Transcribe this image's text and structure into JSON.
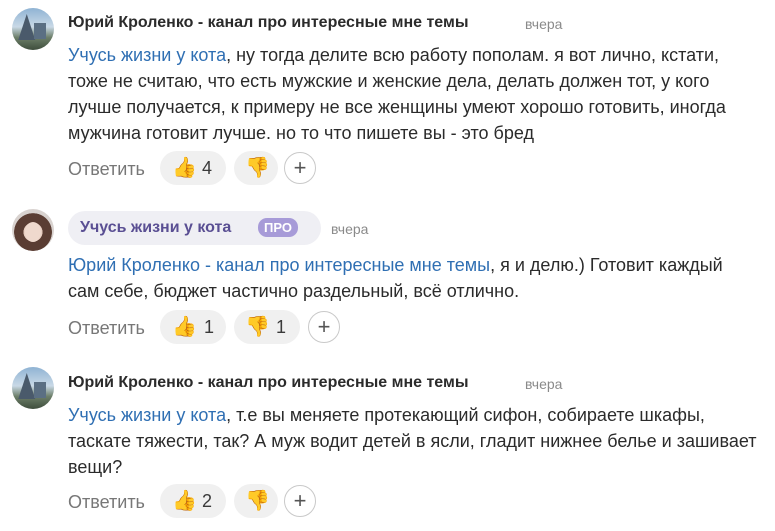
{
  "reply_label": "Ответить",
  "comments": [
    {
      "author": "Юрий Кроленко - канал про интересные мне темы",
      "time": "вчера",
      "mention": "Учусь жизни у кота",
      "text": ", ну тогда делите всю работу пополам. я вот лично, кстати, тоже не считаю, что есть мужские и женские дела, делать должен тот, у кого лучше получается, к примеру не все женщины умеют хорошо готовить, иногда мужчина готовит лучше. но то что пишете вы - это бред",
      "likes": "4",
      "dislikes": ""
    },
    {
      "author": "Учусь жизни у кота",
      "badge": "ПРО",
      "time": "вчера",
      "mention": "Юрий Кроленко - канал про интересные мне темы",
      "text": ", я и делю.) Готовит каждый сам себе, бюджет частично раздельный, всё отлично.",
      "likes": "1",
      "dislikes": "1"
    },
    {
      "author": "Юрий Кроленко - канал про интересные мне темы",
      "time": "вчера",
      "mention": "Учусь жизни у кота",
      "text": ", т.е вы меняете протекающий сифон, собираете шкафы, таскате тяжести, так? А муж водит детей в ясли, гладит нижнее белье и зашивает вещи?",
      "likes": "2",
      "dislikes": ""
    }
  ],
  "icons": {
    "like": "thumbs-up-icon",
    "dislike": "thumbs-down-icon",
    "add": "plus-icon"
  },
  "colors": {
    "mention": "#2f6fb3",
    "author_pro": "#5a4f93",
    "badge": "#a79bd8",
    "muted": "#8a8a8a"
  }
}
